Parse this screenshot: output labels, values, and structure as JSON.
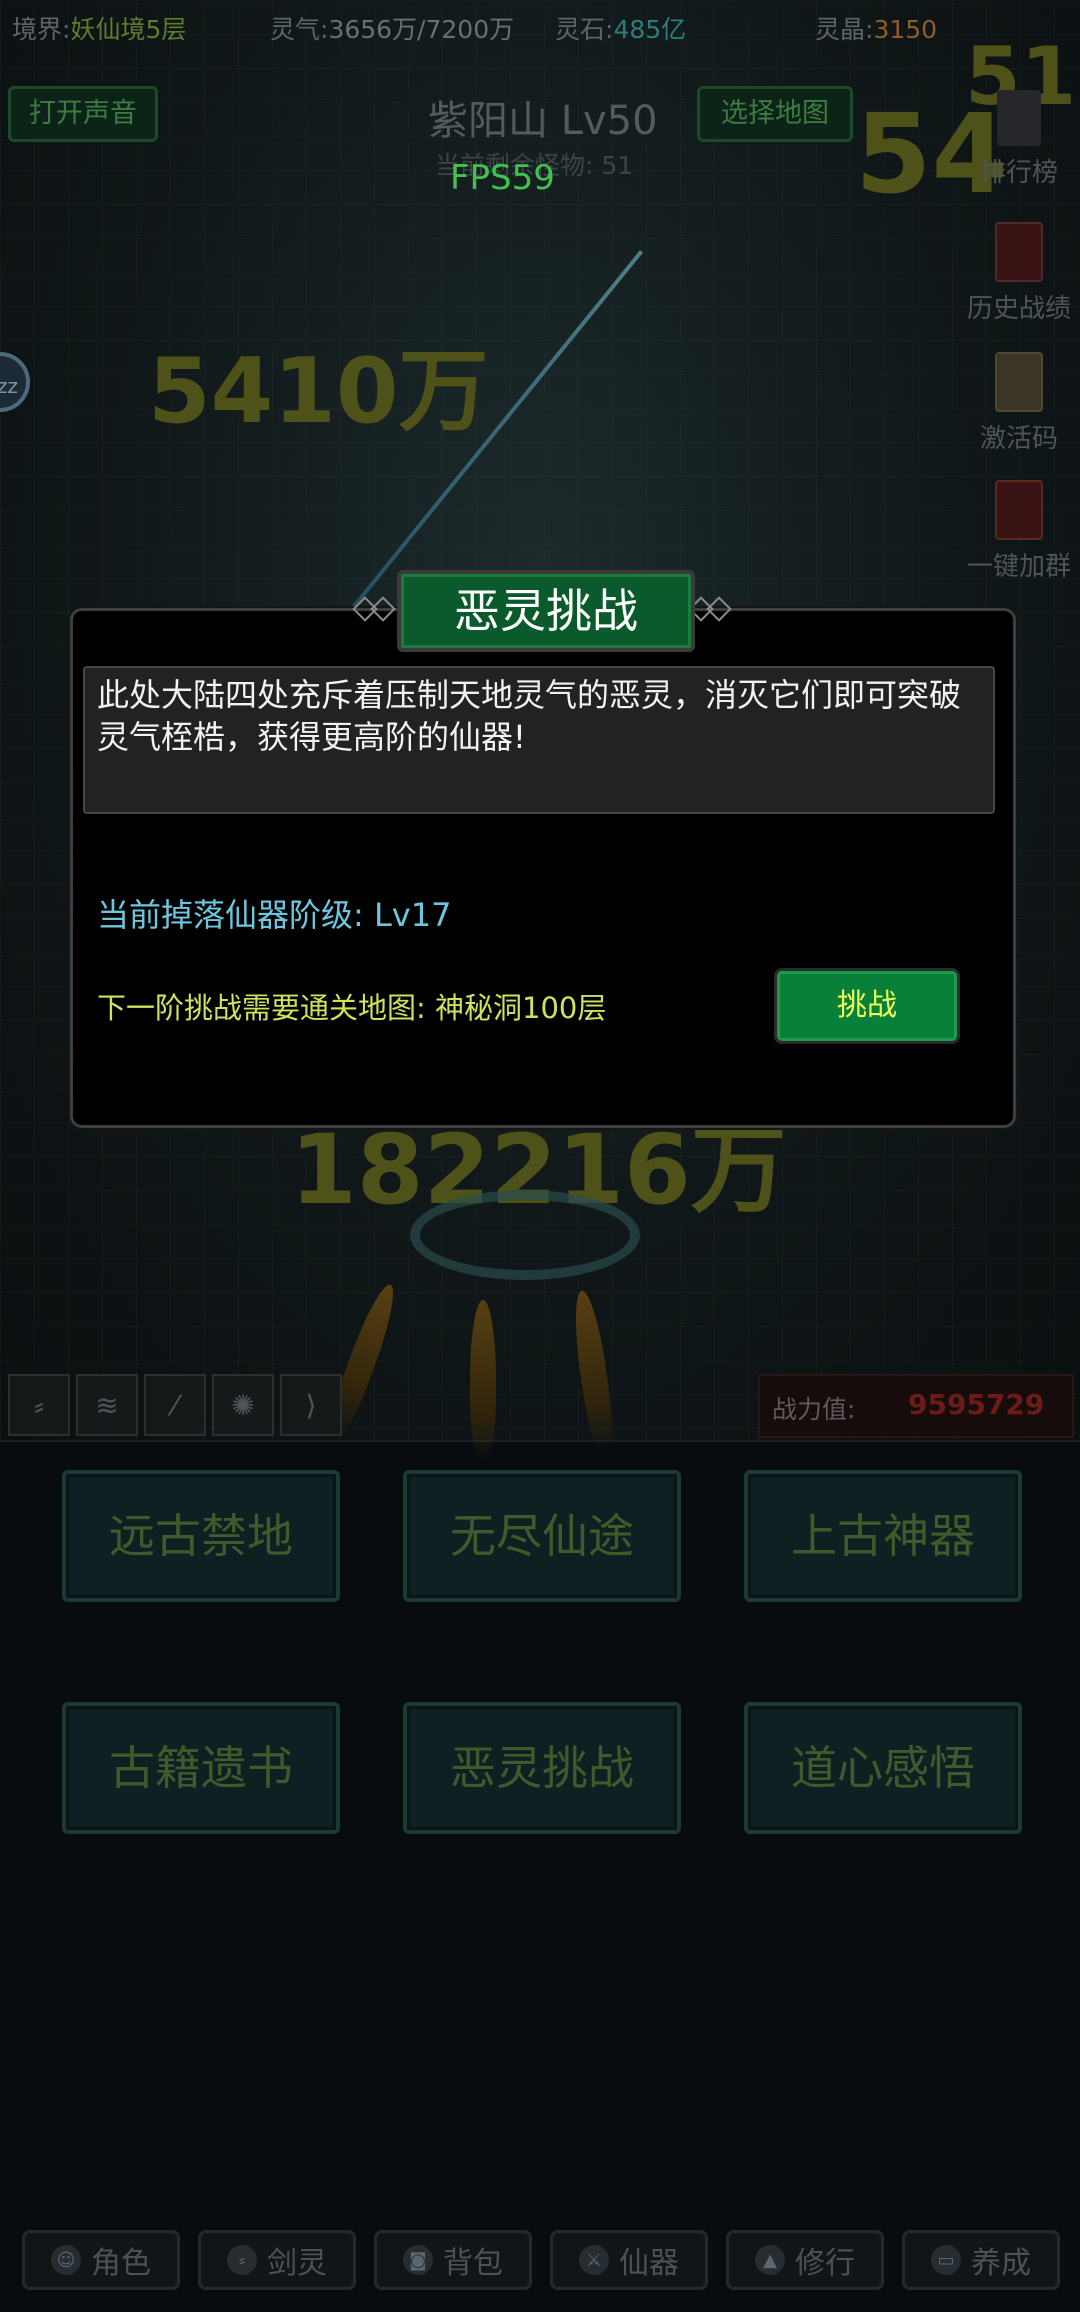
{
  "status_bar": {
    "realm_label": "境界:",
    "realm_value": "妖仙境5层",
    "qi_label": "灵气:",
    "qi_value": "3656万/7200万",
    "stone_label": "灵石:",
    "stone_value": "485亿",
    "crystal_label": "灵晶:",
    "crystal_value": "3150"
  },
  "sound_button": "打开声音",
  "map": {
    "title": "紫阳山 Lv50",
    "remaining": "当前剩余怪物: 51",
    "select_button": "选择地图"
  },
  "fps": "FPS59",
  "damage_numbers": [
    "5410万",
    "54",
    "51",
    "182216万"
  ],
  "side_buttons": [
    {
      "label": "排行榜",
      "icon": "trophy-icon"
    },
    {
      "label": "历史战绩",
      "icon": "history-book-icon"
    },
    {
      "label": "激活码",
      "icon": "scroll-icon"
    },
    {
      "label": "一键加群",
      "icon": "group-icon"
    }
  ],
  "avatar_text": "zz",
  "skills": [
    "spear-skill-icon",
    "whirlwind-skill-icon",
    "flame-skill-icon",
    "vortex-skill-icon",
    "bow-skill-icon"
  ],
  "power": {
    "label": "战力值:",
    "value": "9595729"
  },
  "menu": [
    {
      "label": "远古禁地"
    },
    {
      "label": "无尽仙途"
    },
    {
      "label": "上古神器"
    },
    {
      "label": "古籍遗书"
    },
    {
      "label": "恶灵挑战"
    },
    {
      "label": "道心感悟"
    }
  ],
  "nav": [
    {
      "label": "角色",
      "icon": "character-icon"
    },
    {
      "label": "剑灵",
      "icon": "sword-spirit-icon"
    },
    {
      "label": "背包",
      "icon": "bag-icon"
    },
    {
      "label": "仙器",
      "icon": "artifact-icon"
    },
    {
      "label": "修行",
      "icon": "cultivation-icon"
    },
    {
      "label": "养成",
      "icon": "nurture-icon"
    }
  ],
  "dialog": {
    "title": "恶灵挑战",
    "description": "此处大陆四处充斥着压制天地灵气的恶灵，消灭它们即可突破灵气桎梏，获得更高阶的仙器!",
    "drop_level": "当前掉落仙器阶级: Lv17",
    "next_requirement": "下一阶挑战需要通关地图: 神秘洞100层",
    "challenge_button": "挑战"
  },
  "colors": {
    "dialog_title_bg": "#0a5a2c",
    "challenge_button_bg": "#09803a",
    "challenge_button_text": "#f0ff57",
    "drop_level_text": "#6cc7de",
    "requirement_text": "#d2e05a",
    "power_value": "#6d1b16"
  }
}
